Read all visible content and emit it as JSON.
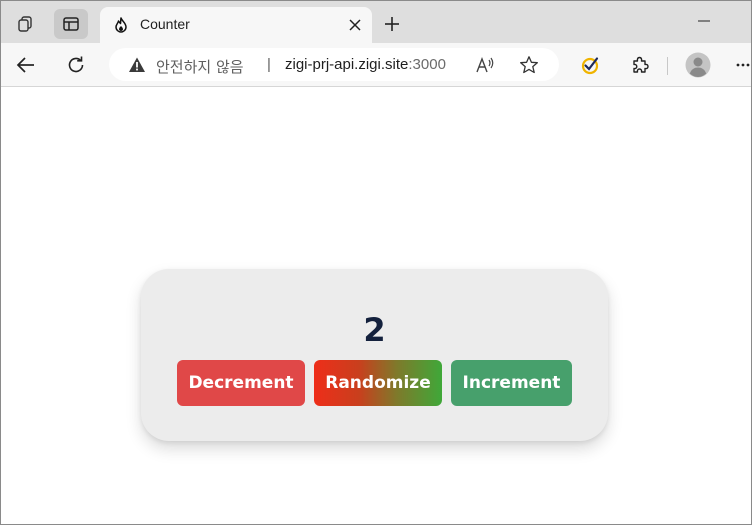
{
  "browser": {
    "tab": {
      "title": "Counter",
      "favicon": "flame-logo-icon"
    },
    "address_bar": {
      "security_text": "안전하지 않음",
      "separator": "|",
      "host": "zigi-prj-api.zigi.site",
      "port": ":3000"
    },
    "icons": {
      "workspaces": "workspaces-icon",
      "vertical_tabs": "vertical-tabs-icon",
      "close_tab": "close-icon",
      "new_tab": "plus-icon",
      "minimize": "minimize-icon",
      "back": "back-arrow-icon",
      "refresh": "refresh-icon",
      "warning": "warning-icon",
      "read_aloud": "read-aloud-icon",
      "favorite": "star-icon",
      "extension_check": "checkmark-extension-icon",
      "extensions": "puzzle-icon",
      "profile": "profile-avatar-icon",
      "more": "more-icon"
    }
  },
  "counter": {
    "value": "2",
    "buttons": {
      "decrement": "Decrement",
      "randomize": "Randomize",
      "increment": "Increment"
    }
  },
  "colors": {
    "decrement": "#e04848",
    "randomize_start": "#ee2e1a",
    "randomize_end": "#3fa839",
    "increment": "#47a06c",
    "count_text": "#14213d",
    "card_bg": "#ececec"
  }
}
